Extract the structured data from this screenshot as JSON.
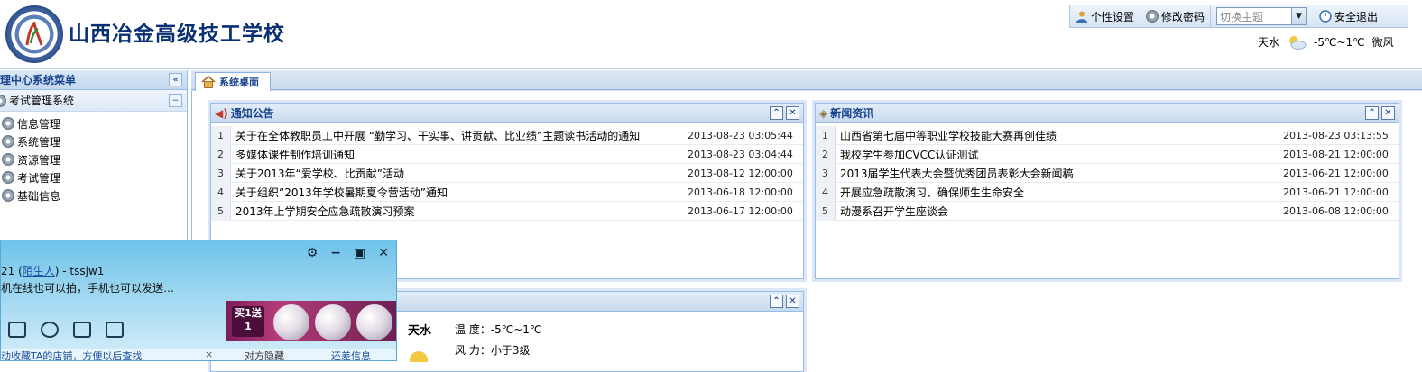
{
  "header": {
    "school_name": "山西冶金高级技工学校",
    "toolbar": {
      "personal_settings": "个性设置",
      "change_password": "修改密码",
      "theme_placeholder": "切换主题",
      "logout": "安全退出"
    },
    "weather": {
      "city": "天水",
      "temp": "-5℃~1℃",
      "wind": "微风"
    }
  },
  "sidebar": {
    "title": "理中心系统菜单",
    "collapse_symbol": "«",
    "group": {
      "label": "考试管理系统",
      "toggle": "−"
    },
    "items": [
      {
        "label": "信息管理"
      },
      {
        "label": "系统管理"
      },
      {
        "label": "资源管理"
      },
      {
        "label": "考试管理"
      },
      {
        "label": "基础信息"
      }
    ]
  },
  "tabs": [
    {
      "label": "系统桌面"
    }
  ],
  "notice_panel": {
    "title": "通知公告",
    "rows": [
      {
        "n": "1",
        "title": "关于在全体教职员工中开展 “勤学习、干实事、讲贡献、比业绩”主题读书活动的通知",
        "date": "2013-08-23 03:05:44"
      },
      {
        "n": "2",
        "title": "多媒体课件制作培训通知",
        "date": "2013-08-23 03:04:44"
      },
      {
        "n": "3",
        "title": "关于2013年“爱学校、比贡献”活动",
        "date": "2013-08-12 12:00:00"
      },
      {
        "n": "4",
        "title": "关于组织“2013年学校暑期夏令营活动”通知",
        "date": "2013-06-18 12:00:00"
      },
      {
        "n": "5",
        "title": "2013年上学期安全应急疏散演习预案",
        "date": "2013-06-17 12:00:00"
      }
    ]
  },
  "news_panel": {
    "title": "新闻资讯",
    "rows": [
      {
        "n": "1",
        "title": "山西省第七届中等职业学校技能大赛再创佳绩",
        "date": "2013-08-23 03:13:55"
      },
      {
        "n": "2",
        "title": "我校学生参加CVCC认证测试",
        "date": "2013-08-21 12:00:00"
      },
      {
        "n": "3",
        "title": "2013届学生代表大会暨优秀团员表彰大会新闻稿",
        "date": "2013-06-21 12:00:00"
      },
      {
        "n": "4",
        "title": "开展应急疏散演习、确保师生生命安全",
        "date": "2013-06-21 12:00:00"
      },
      {
        "n": "5",
        "title": "动漫系召开学生座谈会",
        "date": "2013-06-08 12:00:00"
      }
    ]
  },
  "weather_panel": {
    "city": "天水",
    "temp_label": "温 度：-5℃~1℃",
    "wind_label": "风 力：小于3级"
  },
  "qq_popup": {
    "name_prefix": "21 (",
    "name_link": "陌生人",
    "name_suffix": ") - tssjw1",
    "signature": "机在线也可以拍，手机也可以发送…",
    "ad_text": "买1送1",
    "bottom_text": "动收藏TA的店铺，方便以后查找",
    "bottom_link": "对方隐藏",
    "bottom_link2": "还差信息",
    "close": "×"
  }
}
